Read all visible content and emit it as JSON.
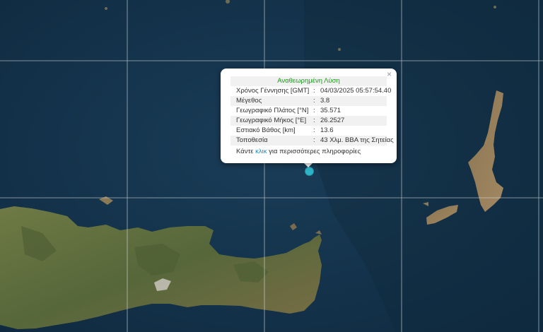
{
  "popup": {
    "title": "Αναθεωρημένη Λύση",
    "close_symbol": "×",
    "rows": [
      {
        "label": "Χρόνος Γέννησης [GMT]",
        "sep": ":",
        "value": "04/03/2025 05:57:54.40"
      },
      {
        "label": "Μέγεθος",
        "sep": ":",
        "value": "3.8"
      },
      {
        "label": "Γεωγραφικό Πλάτος [°N]",
        "sep": ":",
        "value": "35.571"
      },
      {
        "label": "Γεωγραφικό Μήκος [°E]",
        "sep": ":",
        "value": "26.2527"
      },
      {
        "label": "Εστιακό Βάθος [km]",
        "sep": ":",
        "value": "13.6"
      },
      {
        "label": "Τοποθεσία",
        "sep": ":",
        "value": "43 Χλμ. ΒΒΑ της Σητείας"
      }
    ],
    "more_prefix": "Κάντε",
    "more_link": "κλικ",
    "more_suffix": "για περισσότερες πληροφορίες"
  },
  "colors": {
    "sea": "#13324a",
    "land": "#5d6d3a",
    "grid": "#d9dde0",
    "marker": "#2fb3c6",
    "title_green": "#1a9a1a"
  }
}
